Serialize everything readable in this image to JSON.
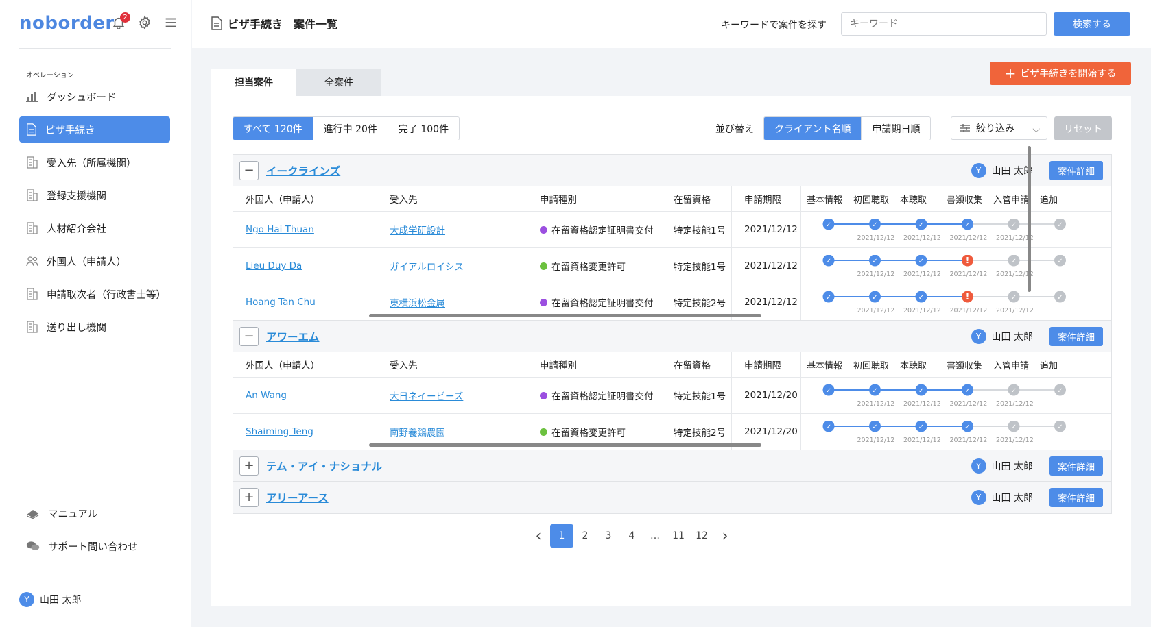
{
  "brand": {
    "logo": "noborder",
    "notification_count": "2"
  },
  "sidebar": {
    "section_label": "オペレーション",
    "items": [
      {
        "label": "ダッシュボード",
        "icon": "chart-icon"
      },
      {
        "label": "ビザ手続き",
        "icon": "document-icon"
      },
      {
        "label": "受入先（所属機関）",
        "icon": "building-icon"
      },
      {
        "label": "登録支援機関",
        "icon": "building-icon"
      },
      {
        "label": "人材紹介会社",
        "icon": "building-icon"
      },
      {
        "label": "外国人（申請人）",
        "icon": "people-icon"
      },
      {
        "label": "申請取次者（行政書士等）",
        "icon": "building-icon"
      },
      {
        "label": "送り出し機関",
        "icon": "building-icon"
      }
    ],
    "manual": "マニュアル",
    "support": "サポート問い合わせ",
    "user_initial": "Y",
    "user_name": "山田 太郎"
  },
  "header": {
    "title": "ビザ手続き　案件一覧",
    "keyword_label": "キーワードで案件を探す",
    "keyword_placeholder": "キーワード",
    "search_button": "検索する"
  },
  "tabs": [
    "担当案件",
    "全案件"
  ],
  "start_button": "ビザ手続きを開始する",
  "filters": [
    "すべて 120件",
    "進行中 20件",
    "完了 100件"
  ],
  "sort": {
    "label": "並び替え",
    "options": [
      "クライアント名順",
      "申請期日順"
    ]
  },
  "narrow": "絞り込み",
  "reset": "リセット",
  "columns": [
    "外国人（申請人）",
    "受入先",
    "申請種別",
    "在留資格",
    "申請期限",
    "基本情報",
    "初回聴取",
    "本聴取",
    "書類収集",
    "入管申請",
    "追加"
  ],
  "colors": {
    "accent": "#4d8ce8",
    "orange": "#f0643a",
    "purple": "#9b4fe0",
    "green": "#6cc13f",
    "error": "#ef5a3c",
    "grey": "#bfc3c8"
  },
  "groups": [
    {
      "name": "イークラインズ",
      "expanded": true,
      "owner_initial": "Y",
      "owner": "山田 太郎",
      "detail": "案件詳細",
      "rows": [
        {
          "applicant": "Ngo Hai Thuan",
          "receiver": "大成学研設計",
          "type": "在留資格認定証明書交付",
          "type_color": "purple",
          "status": "特定技能1号",
          "deadline": "2021/12/12",
          "steps": [
            "done",
            "done",
            "done",
            "done",
            "pending",
            "pending"
          ],
          "dates": [
            "2021/12/12",
            "2021/12/12",
            "2021/12/12",
            "2021/12/12"
          ]
        },
        {
          "applicant": "Lieu Duy Da",
          "receiver": "ガイアルロイシス",
          "type": "在留資格変更許可",
          "type_color": "green",
          "status": "特定技能1号",
          "deadline": "2021/12/12",
          "steps": [
            "done",
            "done",
            "done",
            "error",
            "pending",
            "pending"
          ],
          "dates": [
            "2021/12/12",
            "2021/12/12",
            "2021/12/12",
            "2021/12/12"
          ]
        },
        {
          "applicant": "Hoang Tan Chu",
          "receiver": "東横浜松金属",
          "type": "在留資格認定証明書交付",
          "type_color": "purple",
          "status": "特定技能2号",
          "deadline": "2021/12/12",
          "steps": [
            "done",
            "done",
            "done",
            "error",
            "pending",
            "pending"
          ],
          "dates": [
            "2021/12/12",
            "2021/12/12",
            "2021/12/12",
            "2021/12/12"
          ]
        }
      ]
    },
    {
      "name": "アワーエム",
      "expanded": true,
      "owner_initial": "Y",
      "owner": "山田 太郎",
      "detail": "案件詳細",
      "rows": [
        {
          "applicant": "An Wang",
          "receiver": "大日ネイービーズ",
          "type": "在留資格認定証明書交付",
          "type_color": "purple",
          "status": "特定技能1号",
          "deadline": "2021/12/20",
          "steps": [
            "done",
            "done",
            "done",
            "done",
            "pending",
            "pending"
          ],
          "dates": [
            "2021/12/12",
            "2021/12/12",
            "2021/12/12",
            "2021/12/12"
          ]
        },
        {
          "applicant": "Shaiming Teng",
          "receiver": "南野養鶏農園",
          "type": "在留資格変更許可",
          "type_color": "green",
          "status": "特定技能2号",
          "deadline": "2021/12/20",
          "steps": [
            "done",
            "done",
            "done",
            "done",
            "pending",
            "pending"
          ],
          "dates": [
            "2021/12/12",
            "2021/12/12",
            "2021/12/12",
            "2021/12/12"
          ]
        }
      ]
    },
    {
      "name": "テム・アイ・ナショナル",
      "expanded": false,
      "owner_initial": "Y",
      "owner": "山田 太郎",
      "detail": "案件詳細",
      "rows": []
    },
    {
      "name": "アリーアース",
      "expanded": false,
      "owner_initial": "Y",
      "owner": "山田 太郎",
      "detail": "案件詳細",
      "rows": []
    }
  ],
  "pagination": {
    "pages": [
      "1",
      "2",
      "3",
      "4",
      "…",
      "11",
      "12"
    ],
    "current": "1"
  }
}
